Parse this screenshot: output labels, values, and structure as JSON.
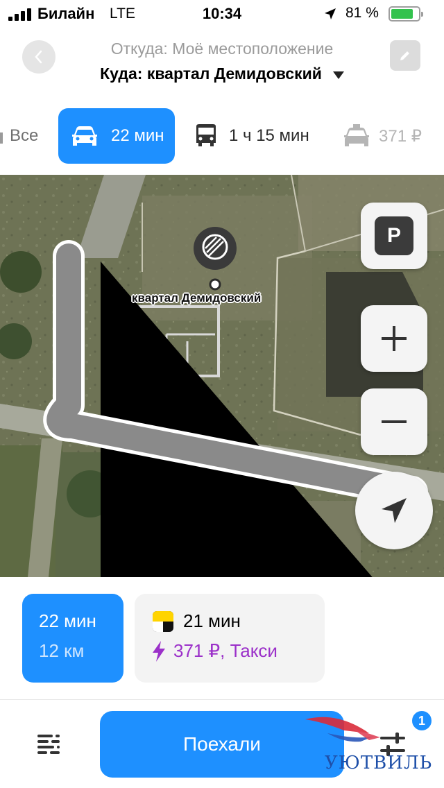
{
  "status_bar": {
    "carrier": "Билайн",
    "network": "LTE",
    "time": "10:34",
    "battery_percent": "81 %",
    "battery_level": 0.81
  },
  "route": {
    "from": "Откуда: Моё местоположение",
    "to": "Куда: квартал Демидовский"
  },
  "tabs": [
    {
      "label": "Все",
      "icon": "all-modes-icon",
      "selected": false
    },
    {
      "label": "22 мин",
      "icon": "car-icon",
      "selected": true
    },
    {
      "label": "1 ч 15 мин",
      "icon": "bus-icon",
      "selected": false
    },
    {
      "label": "371 ₽",
      "icon": "taxi-icon",
      "selected": false
    }
  ],
  "map": {
    "destination_label": "квартал Демидовский",
    "parking_label": "P",
    "route_color": "#8a8a8a"
  },
  "cards": {
    "car": {
      "time": "22 мин",
      "distance": "12 км"
    },
    "taxi": {
      "time": "21 мин",
      "price": "371 ₽, Такси"
    }
  },
  "bottom_bar": {
    "go_label": "Поехали",
    "badge_count": "1",
    "watermark": "УЮТВИЛЬ"
  },
  "colors": {
    "accent": "#1e90ff",
    "taxi_purple": "#9b30c9",
    "battery_green": "#33c24d"
  }
}
